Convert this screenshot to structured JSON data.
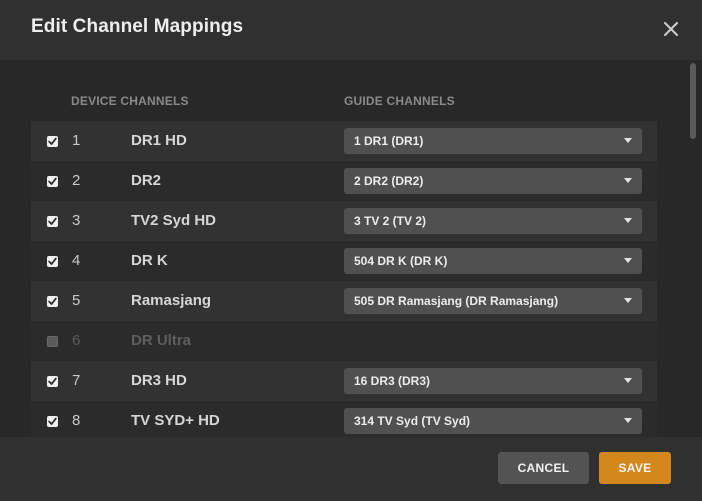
{
  "dialog": {
    "title": "Edit Channel Mappings"
  },
  "columns": {
    "device": "DEVICE CHANNELS",
    "guide": "GUIDE CHANNELS"
  },
  "rows": [
    {
      "checked": true,
      "number": "1",
      "name": "DR1 HD",
      "guide": "1 DR1 (DR1)"
    },
    {
      "checked": true,
      "number": "2",
      "name": "DR2",
      "guide": "2 DR2 (DR2)"
    },
    {
      "checked": true,
      "number": "3",
      "name": "TV2 Syd HD",
      "guide": "3 TV 2 (TV 2)"
    },
    {
      "checked": true,
      "number": "4",
      "name": "DR K",
      "guide": "504 DR K (DR K)"
    },
    {
      "checked": true,
      "number": "5",
      "name": "Ramasjang",
      "guide": "505 DR Ramasjang (DR Ramasjang)"
    },
    {
      "checked": false,
      "number": "6",
      "name": "DR Ultra",
      "guide": ""
    },
    {
      "checked": true,
      "number": "7",
      "name": "DR3 HD",
      "guide": "16 DR3 (DR3)"
    },
    {
      "checked": true,
      "number": "8",
      "name": "TV SYD+ HD",
      "guide": "314 TV Syd (TV Syd)"
    }
  ],
  "footer": {
    "cancel_label": "CANCEL",
    "save_label": "SAVE"
  },
  "colors": {
    "accent": "#d4881c",
    "background": "#2b2b2b",
    "select_background": "#505050"
  },
  "icons": {
    "close": "close-icon",
    "checkbox": "checkmark-icon",
    "dropdown": "caret-down-icon"
  }
}
